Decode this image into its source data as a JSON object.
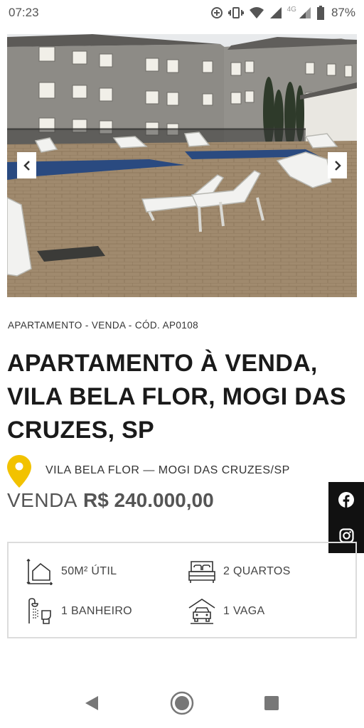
{
  "status_bar": {
    "time": "07:23",
    "network_label": "4G",
    "battery": "87%"
  },
  "listing": {
    "breadcrumb": "APARTAMENTO - VENDA - CÓD. AP0108",
    "title": "APARTAMENTO À VENDA, VILA BELA FLOR, MOGI DAS CRUZES, SP",
    "location": "VILA BELA FLOR — MOGI DAS CRUZES/SP",
    "price_label": "VENDA",
    "price_value": "R$ 240.000,00"
  },
  "features": {
    "area": "50M² ÚTIL",
    "bedrooms": "2 QUARTOS",
    "bathrooms": "1 BANHEIRO",
    "parking": "1 VAGA"
  },
  "icons": {
    "pin": "map-pin-icon",
    "facebook": "facebook-icon",
    "instagram": "instagram-icon",
    "area": "house-area-icon",
    "bed": "bed-icon",
    "bath": "shower-icon",
    "car": "garage-icon"
  },
  "colors": {
    "pin": "#f2c200",
    "social_bg": "#111111",
    "title": "#1a1a1a",
    "border": "#dcdcdc"
  }
}
